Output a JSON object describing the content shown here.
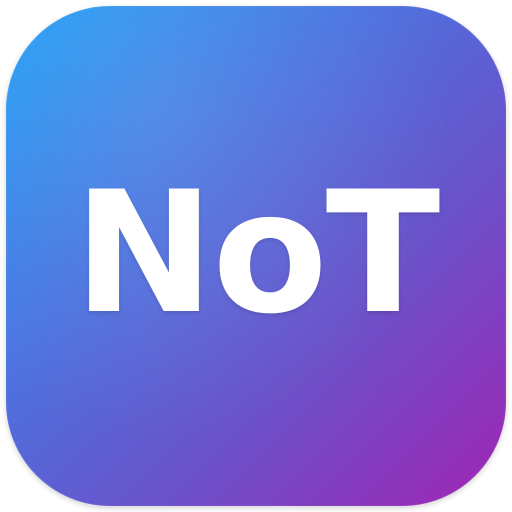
{
  "app_icon": {
    "label": "NoT",
    "colors": {
      "gradient_start": "#1fa0f5",
      "gradient_mid": "#6a52c9",
      "gradient_end": "#a024b4",
      "text": "#ffffff"
    }
  }
}
